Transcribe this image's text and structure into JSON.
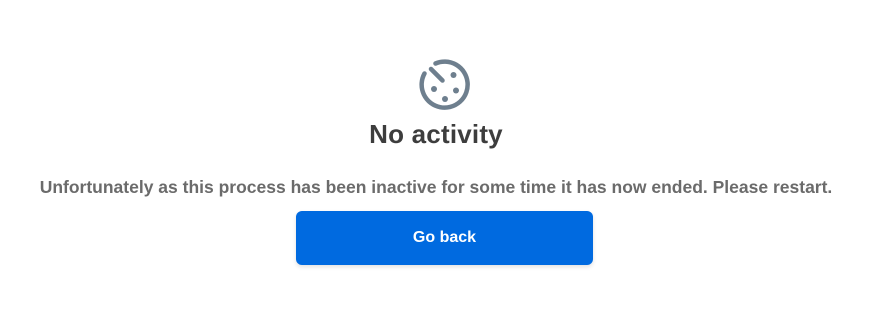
{
  "status": {
    "icon": "timer-off-icon",
    "title": "No activity",
    "message": "Unfortunately as this process has been inactive for some time it has now ended. Please restart."
  },
  "actions": {
    "back_label": "Go back"
  },
  "colors": {
    "accent": "#006ae0",
    "icon": "#6e7f8e",
    "title": "#3d3d3d",
    "message": "#6b6b6b"
  }
}
